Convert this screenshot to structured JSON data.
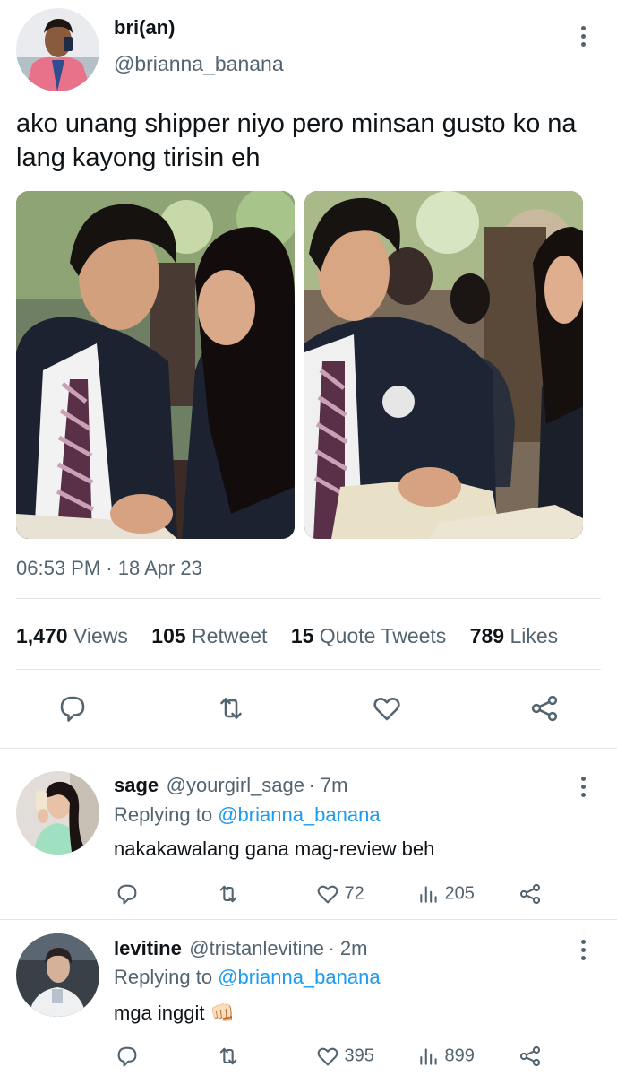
{
  "tweet": {
    "author_name": "bri(an)",
    "author_handle": "@brianna_banana",
    "text": "ako unang shipper niyo pero minsan gusto ko na lang kayong tirisin eh",
    "timestamp": "06:53 PM · 18 Apr 23",
    "stats": {
      "views_count": "1,470",
      "views_label": "Views",
      "retweets_count": "105",
      "retweets_label": "Retweet",
      "quotes_count": "15",
      "quotes_label": "Quote Tweets",
      "likes_count": "789",
      "likes_label": "Likes"
    },
    "actions": [
      "reply-icon",
      "retweet-icon",
      "like-icon",
      "share-icon"
    ]
  },
  "replies": [
    {
      "name": "sage",
      "handle": "@yourgirl_sage",
      "time": "· 7m",
      "replying_prefix": "Replying to",
      "replying_to": "@brianna_banana",
      "text": "nakakawalang gana mag-review beh",
      "likes": "72",
      "views": "205"
    },
    {
      "name": "levitine",
      "handle": "@tristanlevitine",
      "time": "· 2m",
      "replying_prefix": "Replying to",
      "replying_to": "@brianna_banana",
      "text": "mga inggit",
      "emoji": "👊🏻",
      "likes": "395",
      "views": "899"
    }
  ],
  "colors": {
    "accent": "#1d9bf0",
    "secondary_text": "#536471",
    "divider": "#e4e7ea"
  }
}
